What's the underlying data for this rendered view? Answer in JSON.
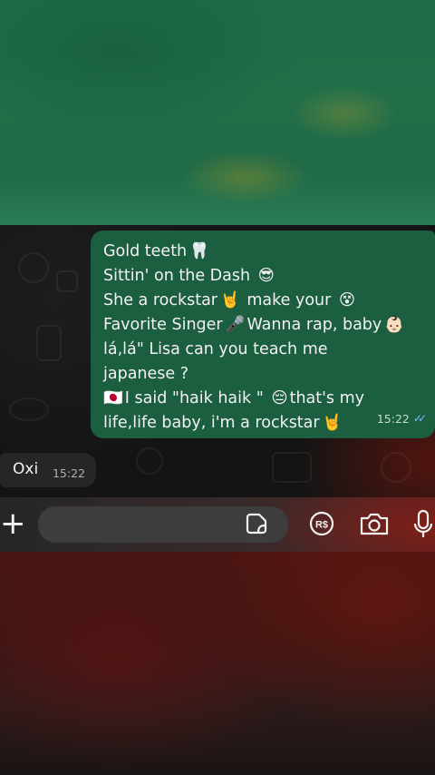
{
  "conversation": {
    "outgoing_message": {
      "lines": [
        "Gold teeth",
        "Sittin' on the Dash",
        "She a rockstar",
        " make your",
        "Favorite Singer",
        "Wanna rap, baby",
        "lá,lá\" Lisa can you teach me",
        "japanese ?",
        "I said \"haik haik \"",
        "that's my",
        "life,life baby, i'm a rockstar"
      ],
      "emojis": {
        "tooth": "🦷",
        "sunglasses": "😎",
        "rock_hand": "🤘",
        "dizzy_face": "😵",
        "microphone": "🎤",
        "baby": "👶🏻",
        "japan_flag": "🇯🇵",
        "pensive": "😔"
      },
      "time": "15:22",
      "status": "read"
    },
    "incoming_message": {
      "text": "Oxi",
      "time": "15:22"
    }
  },
  "composer": {
    "plus_label": "+",
    "message_placeholder": "",
    "payment_label": "R$"
  },
  "colors": {
    "outgoing_bubble": "#1c5e40",
    "incoming_bubble": "#262626",
    "read_ticks": "#7fb7ff"
  }
}
